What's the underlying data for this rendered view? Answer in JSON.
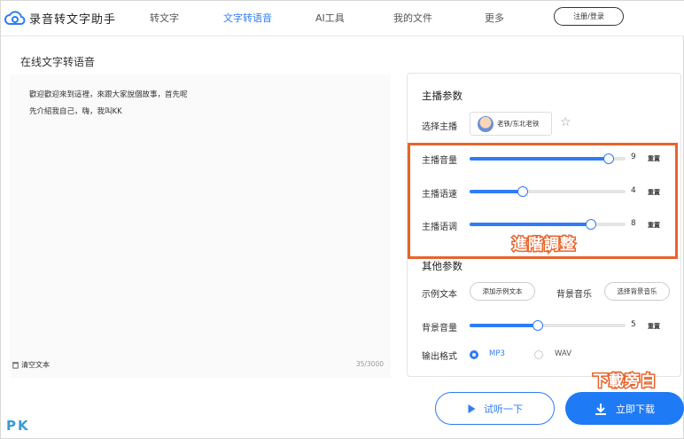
{
  "header": {
    "brand": "录音转文字助手",
    "nav": [
      "转文字",
      "文字转语音",
      "AI工具",
      "我的文件",
      "更多"
    ],
    "active_index": 1,
    "login": "注册/登录"
  },
  "page_title": "在线文字转语音",
  "editor": {
    "lines": [
      "歡迎歡迎來到這裡，來跟大家說個故事，首先呢",
      "先介紹我自己，嗨，我叫KK"
    ],
    "clear_label": "清空文本",
    "char_count": "35/3000"
  },
  "panel": {
    "anchor_section": "主播参数",
    "select_anchor_label": "选择主播",
    "anchor_name": "老铁/东北老铁",
    "sliders": [
      {
        "label": "主播音量",
        "value": "9",
        "fraction": 0.89,
        "reset": "重置"
      },
      {
        "label": "主播语速",
        "value": "4",
        "fraction": 0.34,
        "reset": "重置"
      },
      {
        "label": "主播语调",
        "value": "8",
        "fraction": 0.78,
        "reset": "重置"
      }
    ],
    "other_section": "其他参数",
    "sample_text_label": "示例文本",
    "add_sample_button": "添加示例文本",
    "bg_music_label": "背景音乐",
    "select_music_button": "选择背景音乐",
    "bg_volume": {
      "label": "背景音量",
      "value": "5",
      "fraction": 0.44,
      "reset": "重置"
    },
    "output_format_label": "输出格式",
    "formats": [
      "MP3",
      "WAV"
    ],
    "selected_format": "MP3"
  },
  "annotations": {
    "advanced": "進階調整",
    "download": "下載旁白"
  },
  "buttons": {
    "try_listen": "试听一下",
    "download_now": "立即下载"
  },
  "watermark": "PK",
  "colors": {
    "accent": "#2f7cf6",
    "annotation": "#e8632b"
  }
}
